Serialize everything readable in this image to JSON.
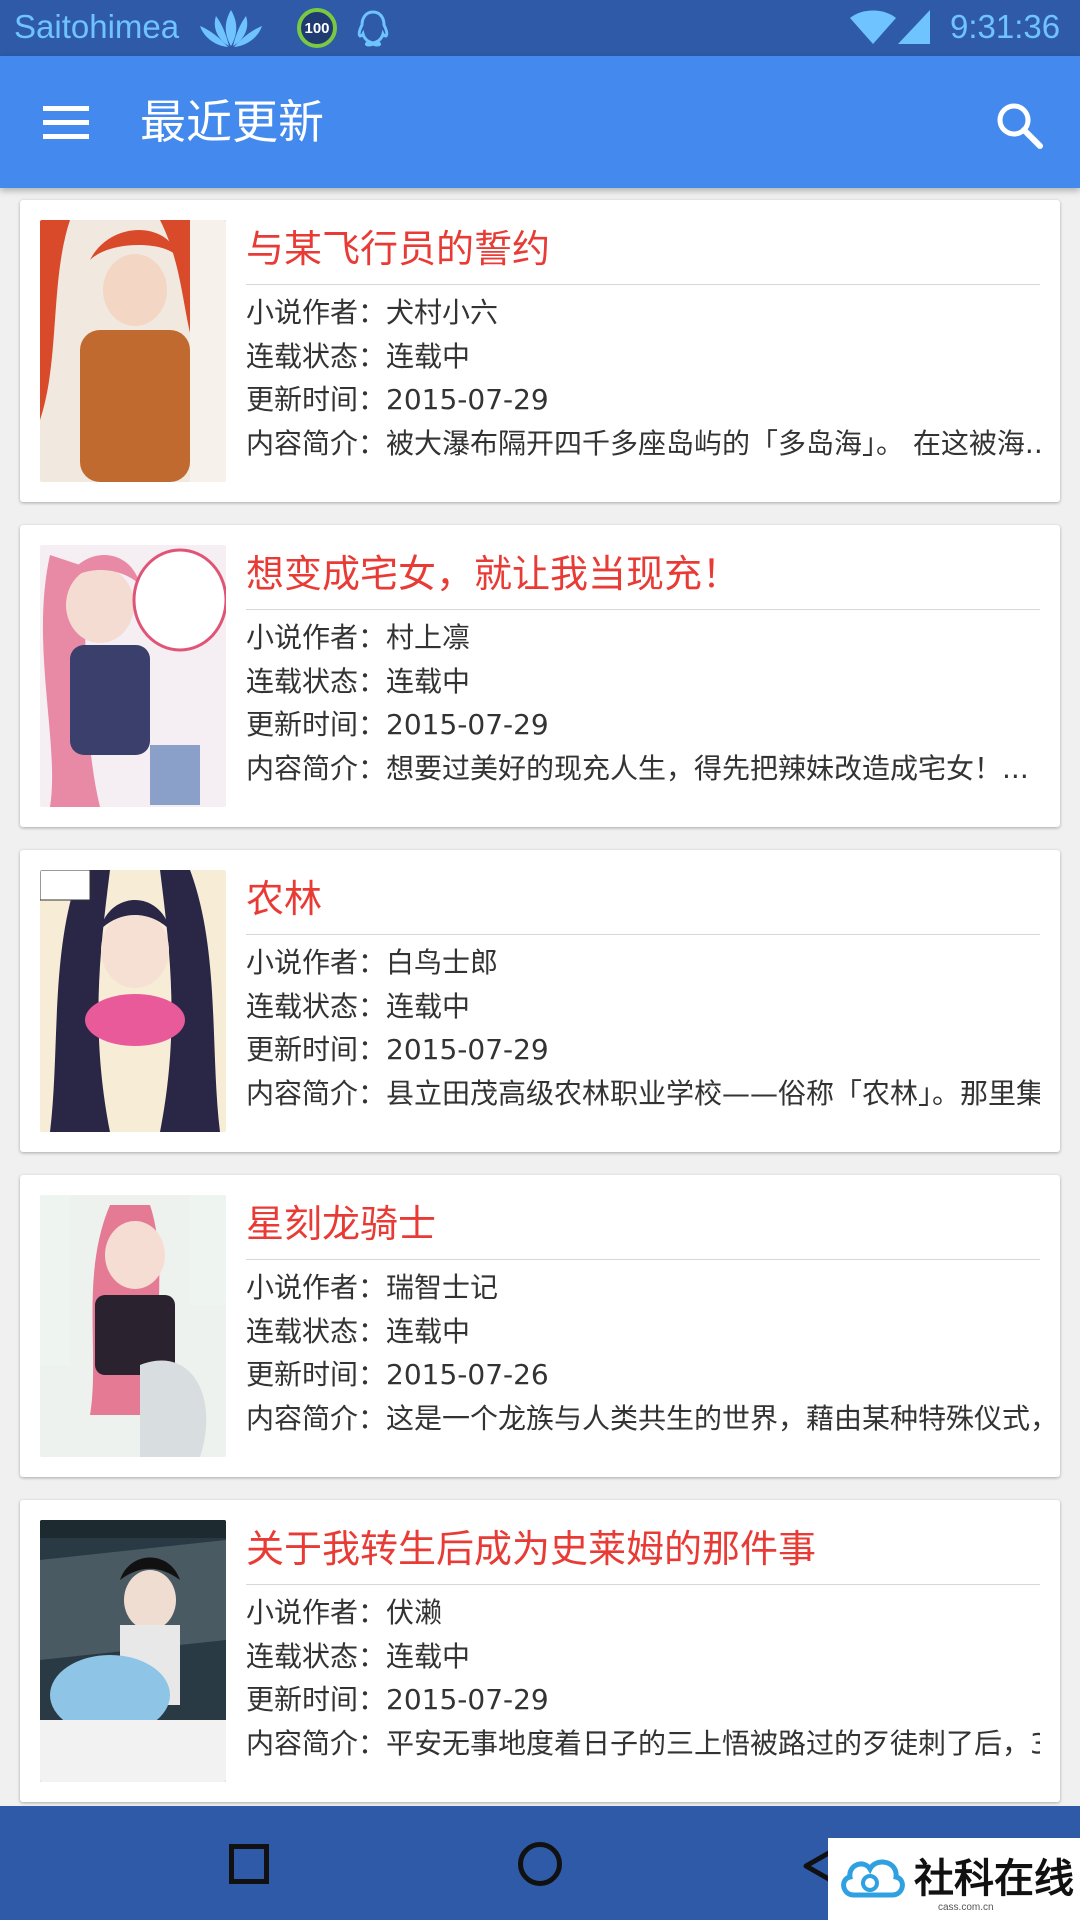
{
  "status_bar": {
    "carrier": "Saitohimea",
    "battery_badge": "100",
    "time": "9:31:36"
  },
  "app_bar": {
    "title": "最近更新",
    "menu_icon": "hamburger-menu-icon",
    "search_icon": "search-icon"
  },
  "labels": {
    "author": "小说作者：",
    "status": "连载状态：",
    "updated": "更新时间：",
    "summary": "内容简介："
  },
  "books": [
    {
      "title": "与某飞行员的誓约",
      "author": "犬村小六",
      "status": "连载中",
      "updated": "2015-07-29",
      "summary": "被大瀑布隔开四千多座岛屿的「多岛海」。 在这被海...",
      "cover_colors": [
        "#d94a2b",
        "#c06a30",
        "#f1e8df"
      ]
    },
    {
      "title": "想变成宅女，就让我当现充！",
      "author": "村上凛",
      "status": "连载中",
      "updated": "2015-07-29",
      "summary": "想要过美好的现充人生，得先把辣妹改造成宅女！...",
      "cover_colors": [
        "#e88aa6",
        "#3b3f6b",
        "#f5eef2"
      ]
    },
    {
      "title": "农林",
      "author": "白鸟士郎",
      "status": "连载中",
      "updated": "2015-07-29",
      "summary": "县立田茂高级农林职业学校——俗称「农林」。那里集...",
      "cover_colors": [
        "#2a2746",
        "#e85a9a",
        "#f7ecd6"
      ]
    },
    {
      "title": "星刻龙骑士",
      "author": "瑞智士记",
      "status": "连载中",
      "updated": "2015-07-26",
      "summary": "这是一个龙族与人类共生的世界，藉由某种特殊仪式，...",
      "cover_colors": [
        "#e47a94",
        "#2b2230",
        "#eef2ee"
      ]
    },
    {
      "title": "关于我转生后成为史莱姆的那件事",
      "author": "伏濑",
      "status": "连载中",
      "updated": "2015-07-29",
      "summary": "平安无事地度着日子的三上悟被路过的歹徒刺了后，3...",
      "cover_colors": [
        "#2a3a44",
        "#8ec4e6",
        "#5a6a4a"
      ]
    }
  ],
  "nav_bar": {
    "recent_icon": "recent-apps-icon",
    "home_icon": "home-icon",
    "back_icon": "back-icon"
  },
  "watermark": {
    "text": "社科在线",
    "sub": "cass.com.cn"
  }
}
